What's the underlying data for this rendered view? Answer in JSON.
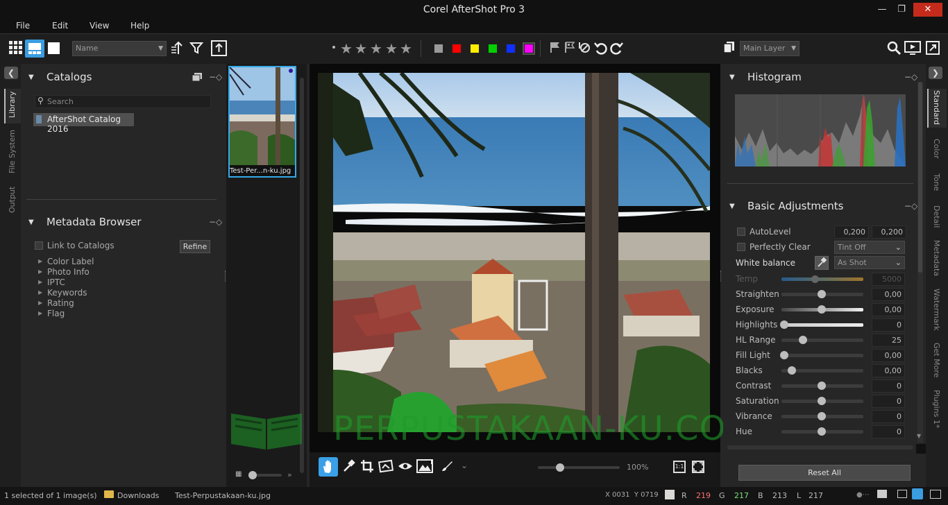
{
  "window": {
    "title": "Corel AfterShot Pro 3"
  },
  "menu": {
    "file": "File",
    "edit": "Edit",
    "view": "View",
    "help": "Help"
  },
  "toolbar": {
    "sort_dropdown": "Name",
    "layer_dropdown": "Main Layer",
    "color_labels": [
      "#9a9a9a",
      "#ff0000",
      "#ffee00",
      "#00d000",
      "#1030ff",
      "#ff00ff"
    ]
  },
  "left_tabs": [
    "Library",
    "File System",
    "Output"
  ],
  "catalogs": {
    "title": "Catalogs",
    "search_placeholder": "Search",
    "items": [
      "AfterShot Catalog 2016"
    ]
  },
  "metadata_browser": {
    "title": "Metadata Browser",
    "link_label": "Link to Catalogs",
    "refine_label": "Refine",
    "items": [
      "Color Label",
      "Photo Info",
      "IPTC",
      "Keywords",
      "Rating",
      "Flag"
    ]
  },
  "filmstrip": {
    "thumb_label": "Test-Per...n-ku.jpg"
  },
  "viewer": {
    "zoom": "100%",
    "watermark": "PERPUSTAKAAN-KU.COM",
    "one_to_one": "1:1"
  },
  "histogram": {
    "title": "Histogram"
  },
  "basic_adjustments": {
    "title": "Basic Adjustments",
    "autolevel": {
      "label": "AutoLevel",
      "v1": "0,200",
      "v2": "0,200"
    },
    "perfectly_clear": {
      "label": "Perfectly Clear",
      "value": "Tint Off"
    },
    "white_balance": {
      "label": "White balance",
      "value": "As Shot"
    },
    "temp": {
      "label": "Temp",
      "value": "5000"
    },
    "sliders": [
      {
        "label": "Straighten",
        "value": "0,00",
        "pos": 0.5
      },
      {
        "label": "Exposure",
        "value": "0,00",
        "pos": 0.5
      },
      {
        "label": "Highlights",
        "value": "0",
        "pos": 0.0
      },
      {
        "label": "HL Range",
        "value": "25",
        "pos": 0.25
      },
      {
        "label": "Fill Light",
        "value": "0,00",
        "pos": 0.0
      },
      {
        "label": "Blacks",
        "value": "0,00",
        "pos": 0.1
      },
      {
        "label": "Contrast",
        "value": "0",
        "pos": 0.5
      },
      {
        "label": "Saturation",
        "value": "0",
        "pos": 0.5
      },
      {
        "label": "Vibrance",
        "value": "0",
        "pos": 0.5
      },
      {
        "label": "Hue",
        "value": "0",
        "pos": 0.5
      }
    ],
    "reset_label": "Reset All"
  },
  "right_tabs": [
    "Standard",
    "Color",
    "Tone",
    "Detail",
    "Metadata",
    "Watermark",
    "Get More",
    "Plugins 1*"
  ],
  "status": {
    "selected": "1 selected of 1 image(s)",
    "folder": "Downloads",
    "filename": "Test-Perpustakaan-ku.jpg",
    "coords": "X 0031  Y 0719",
    "r_label": "R",
    "r": "219",
    "g_label": "G",
    "g": "217",
    "b_label": "B",
    "b": "213",
    "l_label": "L",
    "l": "217"
  }
}
